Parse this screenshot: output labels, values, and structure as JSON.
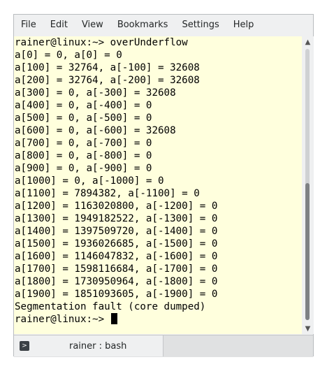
{
  "menubar": {
    "items": [
      "File",
      "Edit",
      "View",
      "Bookmarks",
      "Settings",
      "Help"
    ]
  },
  "terminal": {
    "lines": [
      "rainer@linux:~> overUnderflow",
      "a[0] = 0, a[0] = 0",
      "a[100] = 32764, a[-100] = 32608",
      "a[200] = 32764, a[-200] = 32608",
      "a[300] = 0, a[-300] = 32608",
      "a[400] = 0, a[-400] = 0",
      "a[500] = 0, a[-500] = 0",
      "a[600] = 0, a[-600] = 32608",
      "a[700] = 0, a[-700] = 0",
      "a[800] = 0, a[-800] = 0",
      "a[900] = 0, a[-900] = 0",
      "a[1000] = 0, a[-1000] = 0",
      "a[1100] = 7894382, a[-1100] = 0",
      "a[1200] = 1163020800, a[-1200] = 0",
      "a[1300] = 1949182522, a[-1300] = 0",
      "a[1400] = 1397509720, a[-1400] = 0",
      "a[1500] = 1936026685, a[-1500] = 0",
      "a[1600] = 1146047832, a[-1600] = 0",
      "a[1700] = 1598116684, a[-1700] = 0",
      "a[1800] = 1730950964, a[-1800] = 0",
      "a[1900] = 1851093605, a[-1900] = 0",
      "Segmentation fault (core dumped)"
    ],
    "prompt": "rainer@linux:~> "
  },
  "scrollbar": {
    "icons": {
      "up": "chevron-up-icon",
      "down": "chevron-down-icon"
    }
  },
  "tabbar": {
    "tabs": [
      {
        "label": "rainer : bash",
        "icon": "terminal-icon"
      }
    ]
  },
  "colors": {
    "terminal_background": "#ffffdd",
    "terminal_text": "#000000",
    "chrome": "#eff0f1"
  }
}
